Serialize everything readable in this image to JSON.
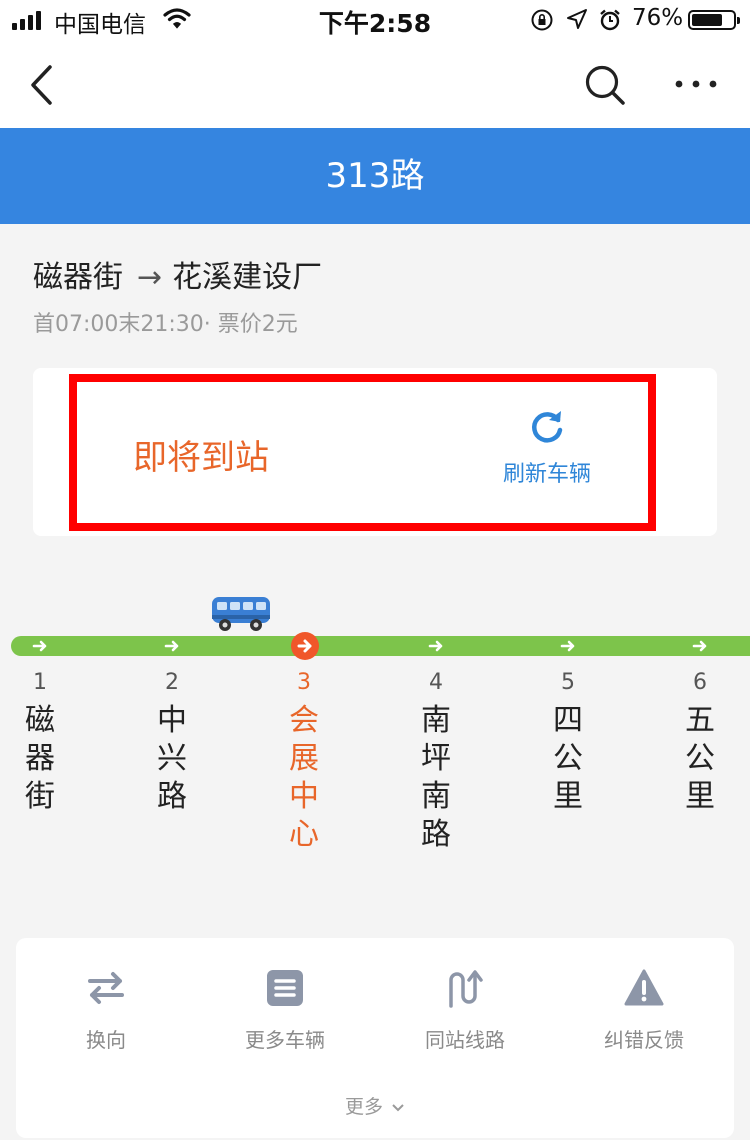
{
  "status_bar": {
    "carrier": "中国电信",
    "time": "下午2:58",
    "battery": "76%"
  },
  "nav": {
    "back_icon": "chevron-left-icon",
    "search_icon": "search-icon",
    "more_icon": "ellipsis-icon"
  },
  "header": {
    "title": "313路"
  },
  "route": {
    "from": "磁器街",
    "arrow": "→",
    "to": "花溪建设厂",
    "meta": "首07:00末21:30· 票价2元"
  },
  "arrival": {
    "status": "即将到站",
    "refresh_label": "刷新车辆"
  },
  "stops": [
    {
      "num": "1",
      "name": "磁器街"
    },
    {
      "num": "2",
      "name": "中兴路"
    },
    {
      "num": "3",
      "name": "会展中心"
    },
    {
      "num": "4",
      "name": "南坪南路"
    },
    {
      "num": "5",
      "name": "四公里"
    },
    {
      "num": "6",
      "name": "五公里"
    }
  ],
  "current_stop_index": 2,
  "actions": [
    {
      "label": "换向",
      "icon": "swap-icon"
    },
    {
      "label": "更多车辆",
      "icon": "list-icon"
    },
    {
      "label": "同站线路",
      "icon": "route-icon"
    },
    {
      "label": "纠错反馈",
      "icon": "warning-icon"
    }
  ],
  "more_label": "更多",
  "colors": {
    "header_blue": "#3585e0",
    "line_green": "#7dc44b",
    "current_orange": "#e8662a",
    "highlight_red": "#ff0000"
  }
}
